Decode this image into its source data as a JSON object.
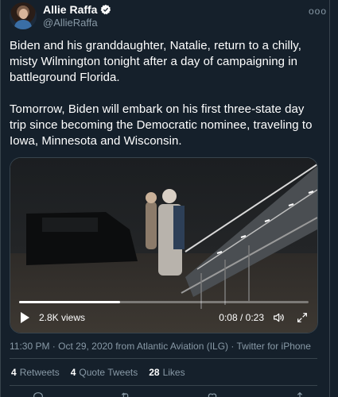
{
  "author": {
    "display_name": "Allie Raffa",
    "handle": "@AllieRaffa",
    "verified": true
  },
  "more_menu": "ooo",
  "tweet": {
    "paragraph_1": "Biden and his granddaughter, Natalie, return to a chilly,\nmisty Wilmington tonight after a day of campaigning in\nbattleground Florida.",
    "paragraph_2": "Tomorrow, Biden will embark on his first three-state day\ntrip since becoming the Democratic nominee, traveling to\nIowa, Minnesota and Wisconsin."
  },
  "video": {
    "views": "2.8K views",
    "time": "0:08 / 0:23",
    "progress_fraction": 0.35
  },
  "meta": {
    "timestamp": "11:30 PM · Oct 29, 2020",
    "from_text": "from Atlantic Aviation (ILG)",
    "source": "Twitter for iPhone",
    "separator": "·"
  },
  "stats": {
    "retweets_count": "4",
    "retweets_label": "Retweets",
    "quotes_count": "4",
    "quotes_label": "Quote Tweets",
    "likes_count": "28",
    "likes_label": "Likes"
  },
  "icons": {
    "verified": "verified-badge-icon",
    "play": "play-icon",
    "volume": "volume-icon",
    "expand": "expand-icon",
    "reply": "reply-icon",
    "retweet": "retweet-icon",
    "like": "like-icon",
    "share": "share-icon"
  },
  "colors": {
    "background": "#15202b",
    "secondary_text": "#8899a6",
    "border": "#38444d",
    "verified": "#1da1f2"
  }
}
